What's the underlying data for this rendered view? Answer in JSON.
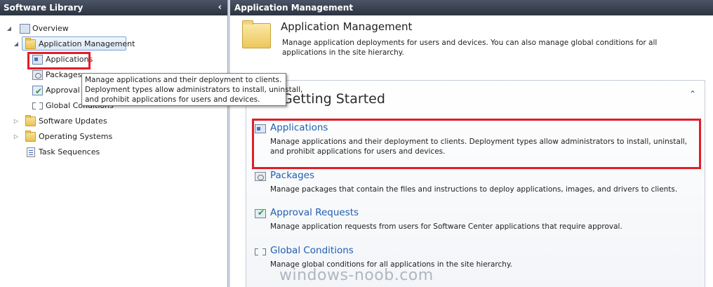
{
  "left_pane": {
    "title": "Software Library",
    "collapse_glyph": "‹",
    "tree": {
      "overview": "Overview",
      "application_management": "Application Management",
      "applications": "Applications",
      "packages": "Packages",
      "approval_requests": "Approval R",
      "global_conditions": "Global Conditions",
      "software_updates": "Software Updates",
      "operating_systems": "Operating Systems",
      "task_sequences": "Task Sequences"
    },
    "tooltip": {
      "line1": "Manage applications and their deployment to clients.",
      "line2": "Deployment types allow administrators to install, uninstall,",
      "line3": "and prohibit applications for users and devices."
    }
  },
  "right_pane": {
    "header": "Application Management",
    "title": "Application Management",
    "description": "Manage application deployments for users and devices. You can also manage global conditions for all applications in the site hierarchy.",
    "getting_started": {
      "title": "Getting Started",
      "items": [
        {
          "label": "Applications",
          "description": "Manage applications and their deployment to clients. Deployment types allow administrators to install, uninstall, and prohibit applications for users and devices."
        },
        {
          "label": "Packages",
          "description": "Manage packages that contain the files and instructions to deploy applications, images, and drivers to clients."
        },
        {
          "label": "Approval Requests",
          "description": "Manage application requests from users for Software Center applications that require approval."
        },
        {
          "label": "Global Conditions",
          "description": "Manage global conditions for all applications in the site hierarchy."
        }
      ]
    }
  },
  "watermark": "windows-noob.com",
  "colors": {
    "header_bg": "#2c3340",
    "link": "#1f5fb0",
    "highlight_red": "#e31d25",
    "selection_border": "#7da2ce"
  }
}
